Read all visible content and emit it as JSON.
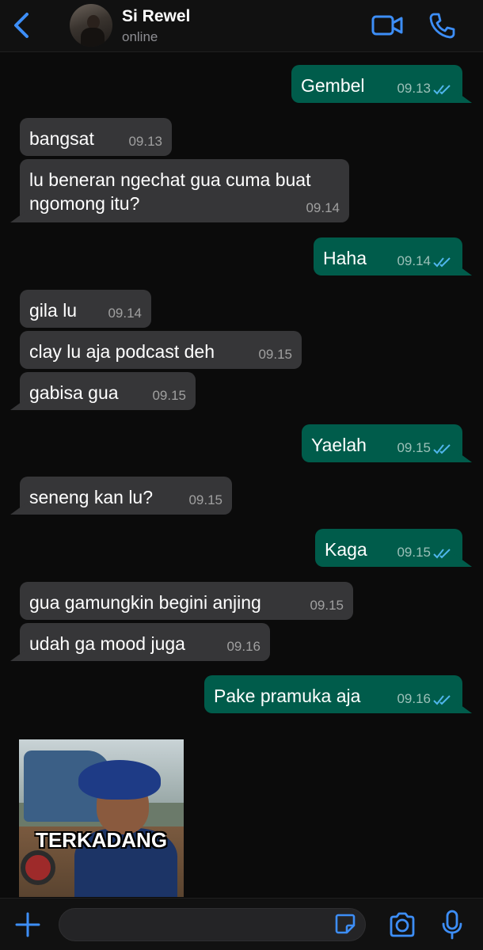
{
  "header": {
    "contact_name": "Si Rewel",
    "status": "online",
    "icons": {
      "back": "chevron-left-icon",
      "video": "video-camera-icon",
      "call": "phone-icon"
    }
  },
  "colors": {
    "accent": "#3d8ef7",
    "incoming_bubble": "#363638",
    "outgoing_bubble": "#005c4b",
    "background": "#0b0b0b"
  },
  "messages": [
    {
      "direction": "out",
      "text": "Gembel",
      "time": "09.13",
      "read": true
    },
    {
      "direction": "in",
      "text": "bangsat",
      "time": "09.13"
    },
    {
      "direction": "in",
      "text": "lu beneran ngechat gua cuma buat",
      "text2": "ngomong itu?",
      "time": "09.14"
    },
    {
      "direction": "out",
      "text": "Haha",
      "time": "09.14",
      "read": true
    },
    {
      "direction": "in",
      "text": "gila lu",
      "time": "09.14"
    },
    {
      "direction": "in",
      "text": "clay lu aja podcast deh",
      "time": "09.15"
    },
    {
      "direction": "in",
      "text": "gabisa gua",
      "time": "09.15"
    },
    {
      "direction": "out",
      "text": "Yaelah",
      "time": "09.15",
      "read": true
    },
    {
      "direction": "in",
      "text": "seneng kan lu?",
      "time": "09.15"
    },
    {
      "direction": "out",
      "text": "Kaga",
      "time": "09.15",
      "read": true
    },
    {
      "direction": "in",
      "text": "gua gamungkin begini anjing",
      "time": "09.15"
    },
    {
      "direction": "in",
      "text": "udah ga mood juga",
      "time": "09.16"
    },
    {
      "direction": "out",
      "text": "Pake pramuka aja",
      "time": "09.16",
      "read": true
    }
  ],
  "media": {
    "caption": "TERKADANG"
  },
  "footer": {
    "input_placeholder": "",
    "icons": {
      "add": "plus-icon",
      "sticker": "sticker-icon",
      "camera": "camera-icon",
      "mic": "microphone-icon"
    }
  }
}
